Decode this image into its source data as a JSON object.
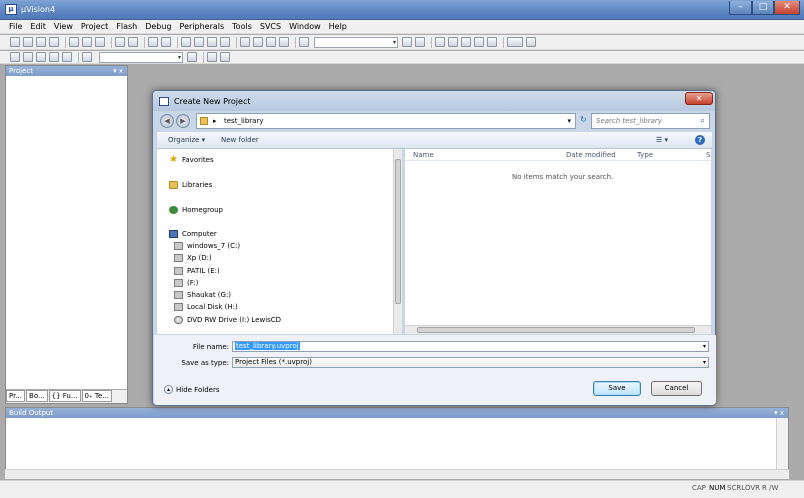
{
  "window": {
    "title": "µVision4",
    "app_icon": "uv-app-icon",
    "min": "–",
    "max": "□",
    "close": "✕"
  },
  "menu": [
    "File",
    "Edit",
    "View",
    "Project",
    "Flash",
    "Debug",
    "Peripherals",
    "Tools",
    "SVCS",
    "Window",
    "Help"
  ],
  "project_pane": {
    "title": "Project",
    "controls": "▾ ⅹ",
    "tabs": [
      "Pr...",
      "Bo...",
      "{} Fu...",
      "0₊ Te..."
    ]
  },
  "build_output": {
    "title": "Build Output",
    "controls": "▾ ⅹ"
  },
  "status": {
    "cap": "CAP",
    "num": "NUM",
    "scrl": "SCRL",
    "ovr": "OVR",
    "rw": "R /W"
  },
  "dialog": {
    "title": "Create New Project",
    "close": "✕",
    "address": {
      "separator": "▸",
      "folder": "test_library"
    },
    "search_placeholder": "Search test_library",
    "organize": "Organize ▾",
    "new_folder": "New folder",
    "nav": {
      "favorites": "Favorites",
      "libraries": "Libraries",
      "homegroup": "Homegroup",
      "computer": "Computer",
      "drives": [
        "windows_7 (C:)",
        "Xp (D:)",
        "PATIL (E:)",
        "(F:)",
        "Shaukat (G:)",
        "Local Disk (H:)",
        "DVD RW Drive (I:) LewisCD"
      ]
    },
    "columns": {
      "name": "Name",
      "date": "Date modified",
      "type": "Type",
      "size": "S"
    },
    "empty_message": "No items match your search.",
    "file_name_label": "File name:",
    "file_name_value": "test_library.uvproj",
    "save_type_label": "Save as type:",
    "save_type_value": "Project Files (*.uvproj)",
    "hide_folders": "Hide Folders",
    "save": "Save",
    "cancel": "Cancel"
  }
}
